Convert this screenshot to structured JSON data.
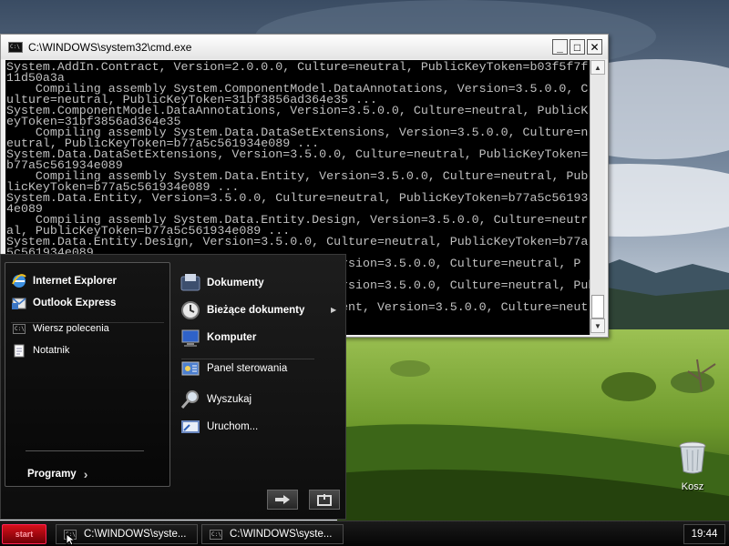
{
  "cmd_window": {
    "title": "C:\\WINDOWS\\system32\\cmd.exe",
    "buttons": {
      "minimize": "_",
      "maximize": "□",
      "close": "✕"
    },
    "lines": [
      "System.AddIn.Contract, Version=2.0.0.0, Culture=neutral, PublicKeyToken=b03f5f7f",
      "11d50a3a",
      "    Compiling assembly System.ComponentModel.DataAnnotations, Version=3.5.0.0, C",
      "ulture=neutral, PublicKeyToken=31bf3856ad364e35 ...",
      "System.ComponentModel.DataAnnotations, Version=3.5.0.0, Culture=neutral, PublicK",
      "eyToken=31bf3856ad364e35",
      "    Compiling assembly System.Data.DataSetExtensions, Version=3.5.0.0, Culture=n",
      "eutral, PublicKeyToken=b77a5c561934e089 ...",
      "System.Data.DataSetExtensions, Version=3.5.0.0, Culture=neutral, PublicKeyToken=",
      "b77a5c561934e089",
      "    Compiling assembly System.Data.Entity, Version=3.5.0.0, Culture=neutral, Pub",
      "licKeyToken=b77a5c561934e089 ...",
      "System.Data.Entity, Version=3.5.0.0, Culture=neutral, PublicKeyToken=b77a5c56193",
      "4e089",
      "    Compiling assembly System.Data.Entity.Design, Version=3.5.0.0, Culture=neutr",
      "al, PublicKeyToken=b77a5c561934e089 ...",
      "System.Data.Entity.Design, Version=3.5.0.0, Culture=neutral, PublicKeyToken=b77a",
      "5c561934e089",
      "                                              rsion=3.5.0.0, Culture=neutral, P",
      "",
      "                                              rsion=3.5.0.0, Culture=neutral, PublicKeyToken=b77a5c561",
      "",
      "                                              ent, Version=3.5.0.0, Culture=neutral",
      ""
    ]
  },
  "start_menu": {
    "left": {
      "pinned": [
        "Internet Explorer",
        "Outlook Express"
      ],
      "recent": [
        "Wiersz polecenia",
        "Notatnik"
      ],
      "programs_label": "Programy"
    },
    "right": {
      "items": [
        "Dokumenty",
        "Bieżące dokumenty",
        "Komputer",
        "Panel sterowania",
        "Wyszukaj",
        "Uruchom..."
      ]
    },
    "buttons": {
      "logoff_icon": "arrow-right-icon",
      "shutdown_icon": "power-icon"
    }
  },
  "desktop": {
    "recycle_bin_label": "Kosz"
  },
  "taskbar": {
    "start_label": "start",
    "tasks": [
      "C:\\WINDOWS\\syste...",
      "C:\\WINDOWS\\syste..."
    ],
    "clock": "19:44"
  },
  "colors": {
    "console_bg": "#000000",
    "console_text": "#c0c0c0",
    "start_button": "#c4101a",
    "taskbar": "#0a0a0a"
  }
}
